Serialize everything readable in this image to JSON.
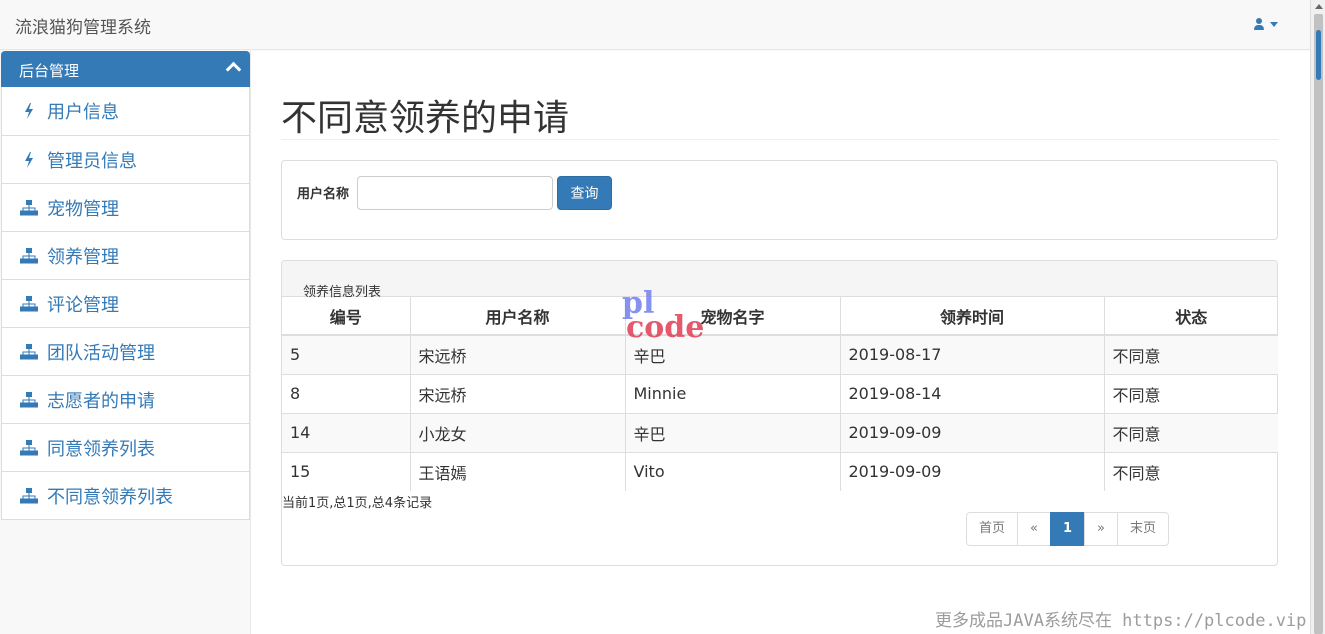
{
  "app": {
    "brand": "流浪猫狗管理系统",
    "user_icon": "user-icon"
  },
  "sidebar": {
    "heading": "后台管理",
    "items": [
      {
        "label": "用户信息",
        "icon": "bolt-icon"
      },
      {
        "label": "管理员信息",
        "icon": "bolt-icon"
      },
      {
        "label": "宠物管理",
        "icon": "sitemap-icon"
      },
      {
        "label": "领养管理",
        "icon": "sitemap-icon"
      },
      {
        "label": "评论管理",
        "icon": "sitemap-icon"
      },
      {
        "label": "团队活动管理",
        "icon": "sitemap-icon"
      },
      {
        "label": "志愿者的申请",
        "icon": "sitemap-icon"
      },
      {
        "label": "同意领养列表",
        "icon": "sitemap-icon"
      },
      {
        "label": "不同意领养列表",
        "icon": "sitemap-icon"
      }
    ]
  },
  "main": {
    "title": "不同意领养的申请",
    "search": {
      "label": "用户名称",
      "value": "",
      "placeholder": "",
      "button": "查询"
    },
    "list": {
      "title": "领养信息列表",
      "columns": [
        "编号",
        "用户名称",
        "宠物名字",
        "领养时间",
        "状态"
      ],
      "rows": [
        [
          "5",
          "宋远桥",
          "辛巴",
          "2019-08-17",
          "不同意"
        ],
        [
          "8",
          "宋远桥",
          "Minnie",
          "2019-08-14",
          "不同意"
        ],
        [
          "14",
          "小龙女",
          "辛巴",
          "2019-09-09",
          "不同意"
        ],
        [
          "15",
          "王语嫣",
          "Vito",
          "2019-09-09",
          "不同意"
        ]
      ],
      "pager_info": "当前1页,总1页,总4条记录",
      "pagination": {
        "first": "首页",
        "prev": "«",
        "current": "1",
        "next": "»",
        "last": "末页"
      }
    }
  },
  "watermark": {
    "logo_top": "pl",
    "logo_bottom": "code",
    "footer": "更多成品JAVA系统尽在 https://plcode.vip"
  },
  "colors": {
    "primary": "#337ab7",
    "navbar_bg": "#f8f8f8",
    "border": "#dddddd"
  }
}
